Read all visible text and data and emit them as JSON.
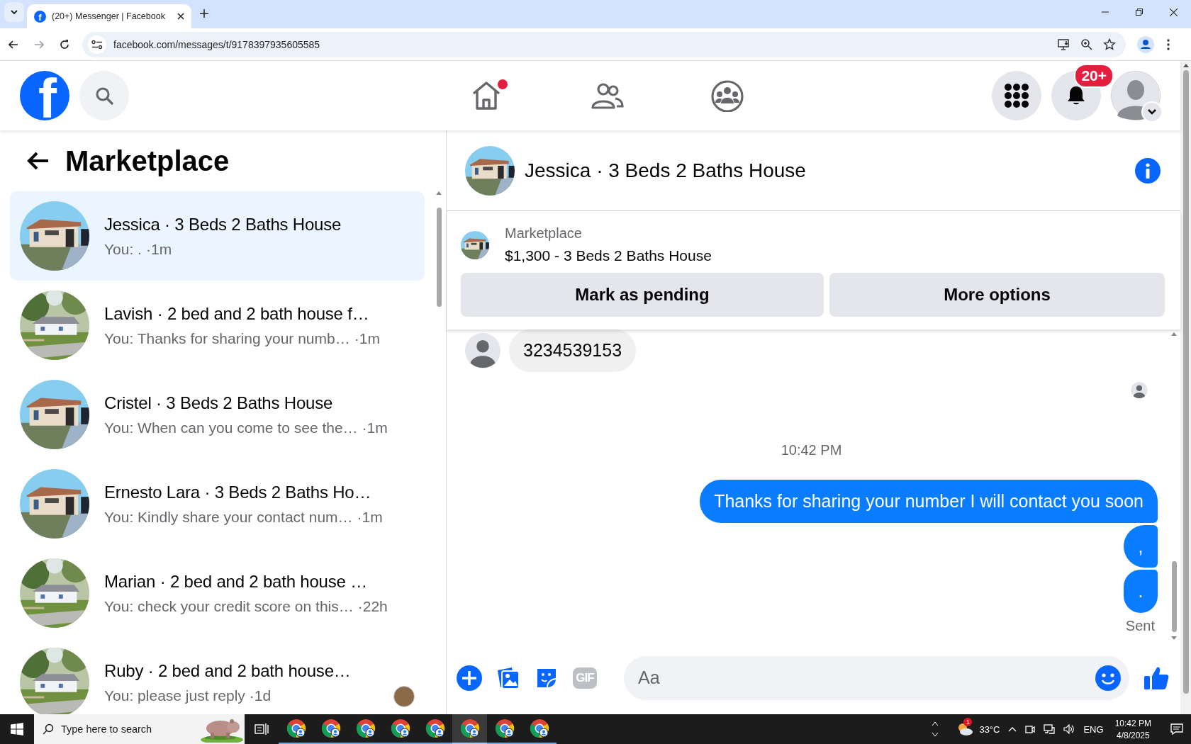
{
  "browser": {
    "tab": {
      "favicon": "f",
      "title": "(20+) Messenger | Facebook"
    },
    "nav": [
      {
        "kind": "back",
        "disabled": false
      },
      {
        "kind": "forward",
        "disabled": true
      },
      {
        "kind": "reload",
        "disabled": false
      }
    ],
    "url": "facebook.com/messages/t/9178397935605585"
  },
  "topbar": {
    "logo": "f",
    "nav": [
      {
        "kind": "home",
        "dot": true
      },
      {
        "kind": "friends",
        "dot": false
      },
      {
        "kind": "groups",
        "dot": false
      }
    ],
    "notifications_badge": "20+"
  },
  "sidebar": {
    "title": "Marketplace",
    "conversations": [
      {
        "name": "Jessica · 3 Beds 2 Baths House",
        "preview": "You: .",
        "time": "·1m",
        "selected": true,
        "seen": false
      },
      {
        "name": "Lavish · 2 bed and 2 bath house f…",
        "preview": "You: Thanks for sharing your numb…",
        "time": "·1m",
        "selected": false,
        "seen": false
      },
      {
        "name": "Cristel · 3 Beds 2 Baths House",
        "preview": "You: When can you come to see the…",
        "time": "·1m",
        "selected": false,
        "seen": false
      },
      {
        "name": "Ernesto Lara · 3 Beds 2 Baths Ho…",
        "preview": "You: Kindly share your contact num…",
        "time": "·1m",
        "selected": false,
        "seen": false
      },
      {
        "name": "Marian · 2 bed and 2 bath house …",
        "preview": "You: check your credit score on this…",
        "time": "·22h",
        "selected": false,
        "seen": false
      },
      {
        "name": "Ruby · 2 bed and 2 bath house…",
        "preview": "You: please just reply",
        "time": "·1d",
        "selected": false,
        "seen": true
      }
    ]
  },
  "chat": {
    "title": "Jessica · 3 Beds 2 Baths House",
    "listing": {
      "label": "Marketplace",
      "title": "$1,300 - 3 Beds 2 Baths House",
      "buttons": [
        "Mark as pending",
        "More options"
      ]
    },
    "messages": [
      {
        "kind": "incoming",
        "text": "3234539153"
      },
      {
        "kind": "seen"
      },
      {
        "kind": "time",
        "text": "10:42 PM"
      },
      {
        "kind": "outgoing",
        "text": "Thanks for sharing your number I will contact you soon"
      },
      {
        "kind": "outgoing",
        "text": ","
      },
      {
        "kind": "outgoing",
        "text": "."
      },
      {
        "kind": "status",
        "text": "Sent"
      }
    ],
    "composer": {
      "gif": "GIF",
      "placeholder": "Aa"
    }
  },
  "taskbar": {
    "search_placeholder": "Type here to search",
    "apps": [
      {
        "selected": false
      },
      {
        "selected": false
      },
      {
        "selected": false
      },
      {
        "selected": false
      },
      {
        "selected": false
      },
      {
        "selected": true
      },
      {
        "selected": false
      },
      {
        "selected": false
      }
    ],
    "weather": {
      "badge": "1",
      "temperature": "33°C"
    },
    "language": "ENG",
    "time": "10:42 PM",
    "date": "4/8/2025"
  }
}
